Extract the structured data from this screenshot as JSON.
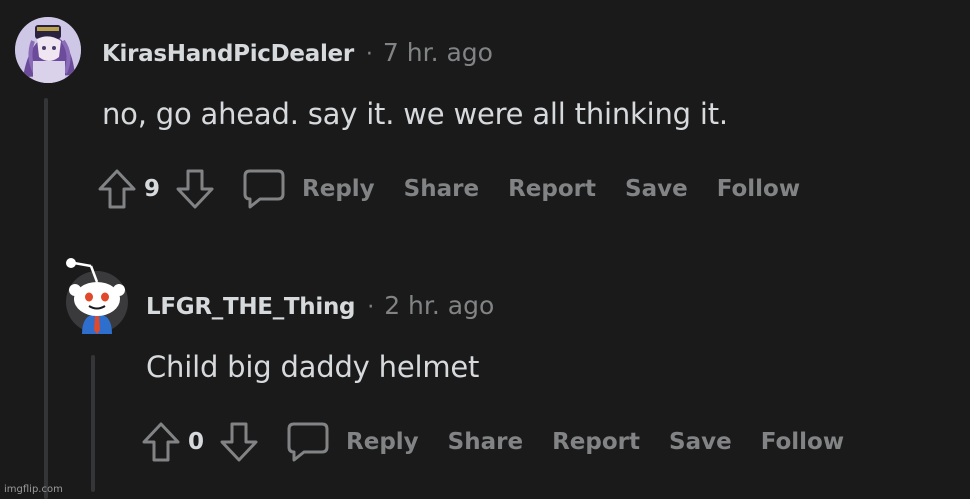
{
  "comments": [
    {
      "username": "KirasHandPicDealer",
      "separator": "·",
      "time": "7 hr. ago",
      "body": "no, go ahead. say it. we were all thinking it.",
      "score": "9",
      "actions": {
        "reply": "Reply",
        "share": "Share",
        "report": "Report",
        "save": "Save",
        "follow": "Follow"
      }
    },
    {
      "username": "LFGR_THE_Thing",
      "separator": "·",
      "time": "2 hr. ago",
      "body": "Child big daddy helmet",
      "score": "0",
      "actions": {
        "reply": "Reply",
        "share": "Share",
        "report": "Report",
        "save": "Save",
        "follow": "Follow"
      }
    }
  ],
  "watermark": "imgflip.com",
  "colors": {
    "background": "#1a1a1b",
    "text": "#d7dadc",
    "muted": "#818384",
    "thread_line": "#343536"
  },
  "icons": [
    "upvote-icon",
    "downvote-icon",
    "comment-icon",
    "snoo-avatar"
  ]
}
